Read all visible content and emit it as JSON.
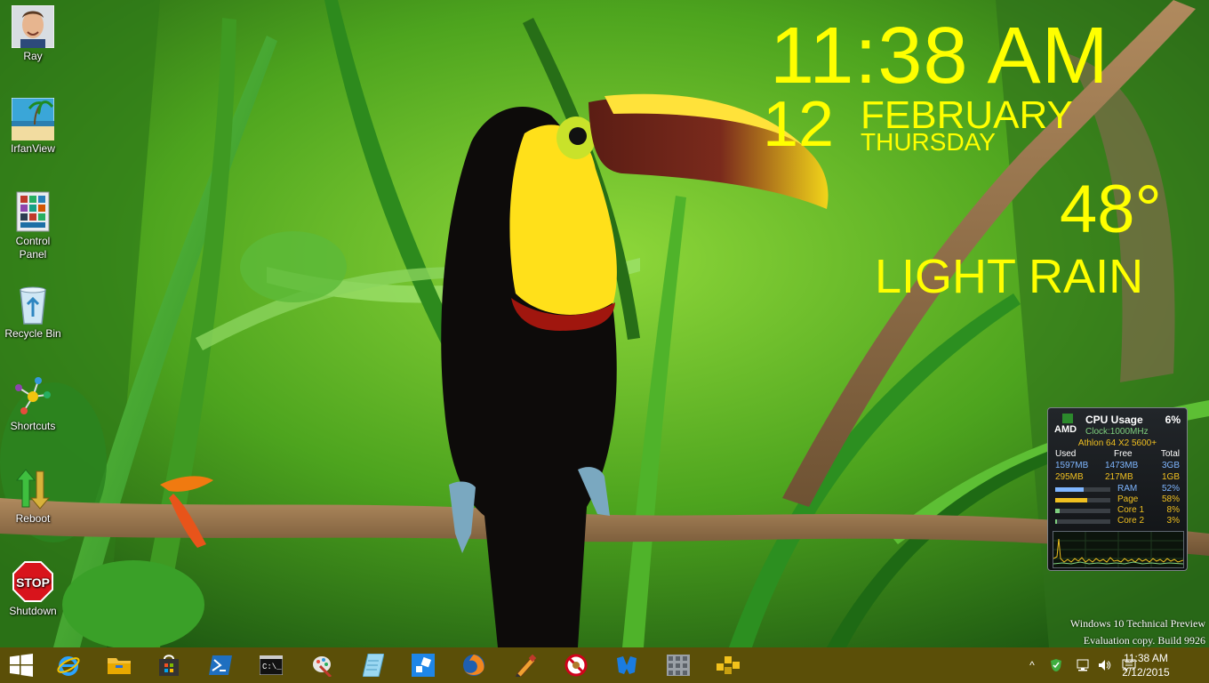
{
  "desktop": {
    "icons": [
      {
        "label": "Ray",
        "icon": "user-photo-icon"
      },
      {
        "label": "IrfanView",
        "icon": "irfanview-icon"
      },
      {
        "label": "Control Panel",
        "icon": "control-panel-icon"
      },
      {
        "label": "Recycle Bin",
        "icon": "recycle-bin-icon"
      },
      {
        "label": "Shortcuts",
        "icon": "shortcuts-icon"
      },
      {
        "label": "Reboot",
        "icon": "reboot-icon"
      },
      {
        "label": "Shutdown",
        "icon": "stop-sign-icon"
      }
    ]
  },
  "overlay": {
    "time": "11:38 AM",
    "day": "12",
    "month": "FEBRUARY",
    "weekday": "THURSDAY",
    "temperature": "48°",
    "condition": "LIGHT RAIN",
    "color": "#ffff00"
  },
  "cpu_gadget": {
    "brand": "AMD",
    "title": "CPU Usage",
    "percent": "6%",
    "clock": "Clock:1000MHz",
    "processor": "Athlon 64 X2 5600+",
    "headers": [
      "Used",
      "Free",
      "Total"
    ],
    "mem_rows": [
      {
        "used": "1597MB",
        "free": "1473MB",
        "total": "3GB"
      },
      {
        "used": "295MB",
        "free": "217MB",
        "total": "1GB"
      }
    ],
    "bars": [
      {
        "name": "RAM",
        "value": "52%",
        "fraction": 0.52,
        "color": "#7fb6ff"
      },
      {
        "name": "Page",
        "value": "58%",
        "fraction": 0.58,
        "color": "#f0c020"
      },
      {
        "name": "Core 1",
        "value": "8%",
        "fraction": 0.08,
        "color": "#7fd07f"
      },
      {
        "name": "Core 2",
        "value": "3%",
        "fraction": 0.03,
        "color": "#7fd07f"
      }
    ]
  },
  "watermark": {
    "line1": "Windows 10 Technical Preview",
    "line2": "Evaluation copy. Build 9926"
  },
  "taskbar": {
    "start": "windows-start-icon",
    "pinned": [
      "internet-explorer-icon",
      "file-explorer-icon",
      "store-icon",
      "powershell-icon",
      "command-prompt-icon",
      "paint-icon",
      "notepad-icon",
      "app-blue-icon",
      "firefox-icon",
      "pen-tool-icon",
      "no-entry-icon",
      "malwarebytes-icon",
      "grid-app-icon",
      "yellow-blocks-icon"
    ],
    "tray": {
      "chevron": "^",
      "time": "11:38 AM",
      "date": "2/12/2015"
    }
  }
}
